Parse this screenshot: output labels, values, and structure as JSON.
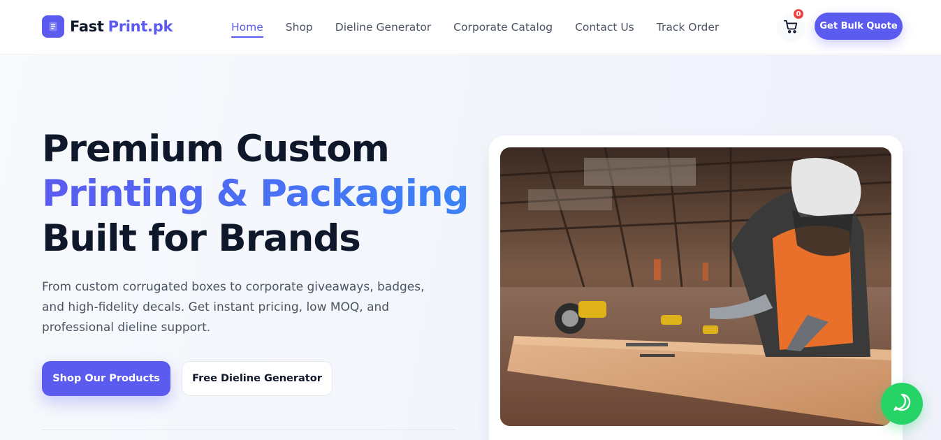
{
  "brand": {
    "name_part1": "Fast",
    "name_part2": "Print.pk",
    "color": "#5b5bf0"
  },
  "nav": {
    "items": [
      {
        "label": "Home",
        "active": true
      },
      {
        "label": "Shop",
        "active": false
      },
      {
        "label": "Dieline Generator",
        "active": false
      },
      {
        "label": "Corporate Catalog",
        "active": false
      },
      {
        "label": "Contact Us",
        "active": false
      },
      {
        "label": "Track Order",
        "active": false
      }
    ]
  },
  "header": {
    "cart_icon": "shopping-cart-icon",
    "cart_count": "0",
    "cta_label": "Get Bulk Quote"
  },
  "hero": {
    "title_line1": "Premium Custom",
    "title_line2": "Printing & Packaging",
    "title_line3": "Built for Brands",
    "subtitle": "From custom corrugated boxes to corporate giveaways, badges, and high-fidelity decals. Get instant pricing, low MOQ, and professional dieline support.",
    "primary_cta": "Shop Our Products",
    "secondary_cta": "Free Dieline Generator"
  },
  "widgets": {
    "chat_icon": "whatsapp-chat-icon"
  },
  "colors": {
    "accent": "#5b5bf0",
    "accent_gradient_end": "#3b82f6",
    "whatsapp": "#25d366",
    "badge": "#ef4444"
  }
}
